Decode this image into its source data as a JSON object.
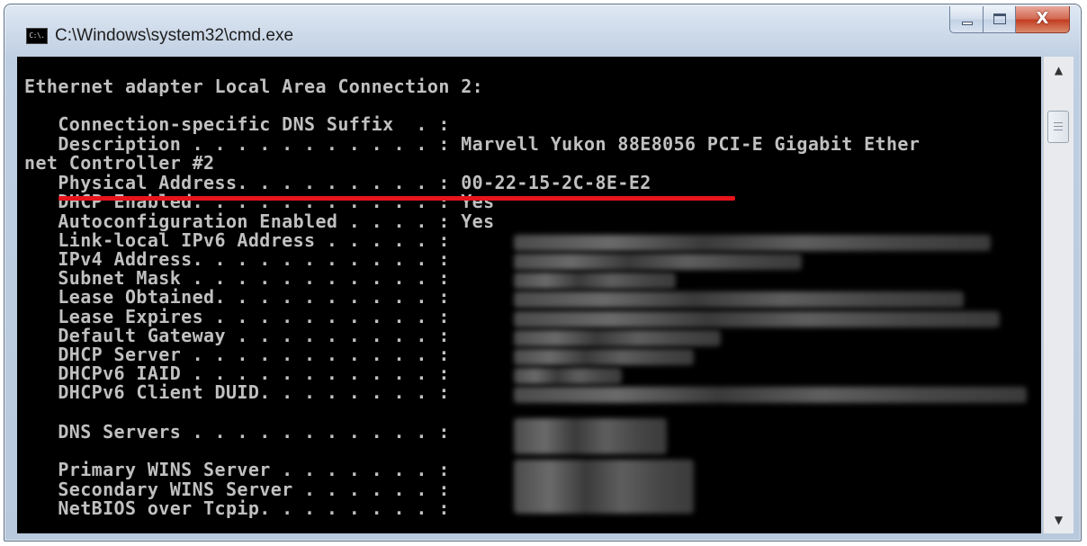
{
  "window": {
    "title": "C:\\Windows\\system32\\cmd.exe",
    "icon_text": "C:\\.",
    "close_glyph": "X"
  },
  "console": {
    "lines": [
      "Ethernet adapter Local Area Connection 2:",
      "",
      "   Connection-specific DNS Suffix  . :",
      "   Description . . . . . . . . . . . : Marvell Yukon 88E8056 PCI-E Gigabit Ether",
      "net Controller #2",
      "   Physical Address. . . . . . . . . : 00-22-15-2C-8E-E2",
      "   DHCP Enabled. . . . . . . . . . . : Yes",
      "   Autoconfiguration Enabled . . . . : Yes",
      "   Link-local IPv6 Address . . . . . :",
      "   IPv4 Address. . . . . . . . . . . :",
      "   Subnet Mask . . . . . . . . . . . :",
      "   Lease Obtained. . . . . . . . . . :",
      "   Lease Expires . . . . . . . . . . :",
      "   Default Gateway . . . . . . . . . :",
      "   DHCP Server . . . . . . . . . . . :",
      "   DHCPv6 IAID . . . . . . . . . . . :",
      "   DHCPv6 Client DUID. . . . . . . . :",
      "",
      "   DNS Servers . . . . . . . . . . . :",
      "",
      "   Primary WINS Server . . . . . . . :",
      "   Secondary WINS Server . . . . . . :",
      "   NetBIOS over Tcpip. . . . . . . . :"
    ]
  },
  "colors": {
    "console_bg": "#000000",
    "console_fg": "#c0c0c0",
    "highlight_line": "#e8141c"
  },
  "icons": {
    "scroll_up": "up-arrow-icon",
    "scroll_down": "down-arrow-icon",
    "minimize": "minimize-icon",
    "maximize": "maximize-icon",
    "close": "close-icon"
  }
}
